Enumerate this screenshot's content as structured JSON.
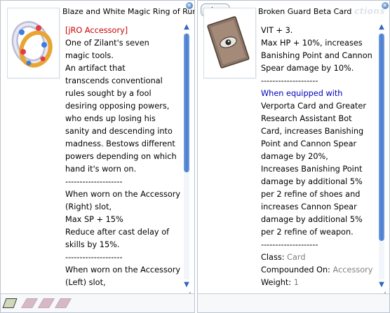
{
  "left": {
    "title": "Blaze and White Magic Ring of Runes",
    "lines": [
      {
        "text": "[jRO Accessory]",
        "cls": "red"
      },
      {
        "text": "One of Zilant's seven"
      },
      {
        "text": "magic tools."
      },
      {
        "text": "An artifact that"
      },
      {
        "text": "transcends conventional"
      },
      {
        "text": "rules sought by a fool"
      },
      {
        "text": "desiring opposing powers,"
      },
      {
        "text": "who ends up losing his"
      },
      {
        "text": "sanity and descending into"
      },
      {
        "text": "madness. Bestows different"
      },
      {
        "text": "powers depending on which"
      },
      {
        "text": "hand it's worn on."
      },
      {
        "text": "--------------------"
      },
      {
        "text": "When worn on the Accessory"
      },
      {
        "text": "(Right) slot,"
      },
      {
        "text": "Max SP + 15%"
      },
      {
        "text": "Reduce after cast delay of"
      },
      {
        "text": "skills by 15%."
      },
      {
        "text": "--------------------"
      },
      {
        "text": "When worn on the Accessory"
      },
      {
        "text": "(Left) slot,"
      }
    ],
    "icons": {
      "close": "close-icon",
      "scroll_up": "scroll-up-arrow-icon",
      "scroll_down": "scroll-down-arrow-icon",
      "item": "rune-ring-icon"
    }
  },
  "right": {
    "title": "Broken Guard Beta Card",
    "ghost_text": "ctions",
    "view_label": "view",
    "lines": [
      {
        "text": "VIT + 3."
      },
      {
        "text": "Max HP + 10%, increases"
      },
      {
        "text": "Banishing Point and Cannon"
      },
      {
        "text": "Spear damage by 10%."
      },
      {
        "text": "--------------------"
      },
      {
        "text": "When equipped with",
        "cls": "blue"
      },
      {
        "text": "Verporta Card and Greater"
      },
      {
        "text": "Research Assistant Bot"
      },
      {
        "text": "Card, increases Banishing"
      },
      {
        "text": "Point and Cannon Spear"
      },
      {
        "text": "damage by 20%,"
      },
      {
        "text": "Increases Banishing Point"
      },
      {
        "text": "damage by additional 5%"
      },
      {
        "text": "per 2 refine of shoes and"
      },
      {
        "text": "increases Cannon Spear"
      },
      {
        "text": "damage by additional 5%"
      },
      {
        "text": "per 2 refine of weapon."
      },
      {
        "text": "--------------------"
      }
    ],
    "props": [
      {
        "label": "Class: ",
        "value": "Card"
      },
      {
        "label": "Compounded On: ",
        "value": "Accessory"
      },
      {
        "label": "Weight: ",
        "value": "1"
      }
    ],
    "icons": {
      "close": "close-icon",
      "scroll_up": "scroll-up-arrow-icon",
      "scroll_down": "scroll-down-arrow-icon",
      "item": "card-eye-icon"
    }
  },
  "colors": {
    "red": "#cc0000",
    "blue": "#0000bb",
    "grey": "#808080",
    "scroll": "#4a7bcb"
  }
}
